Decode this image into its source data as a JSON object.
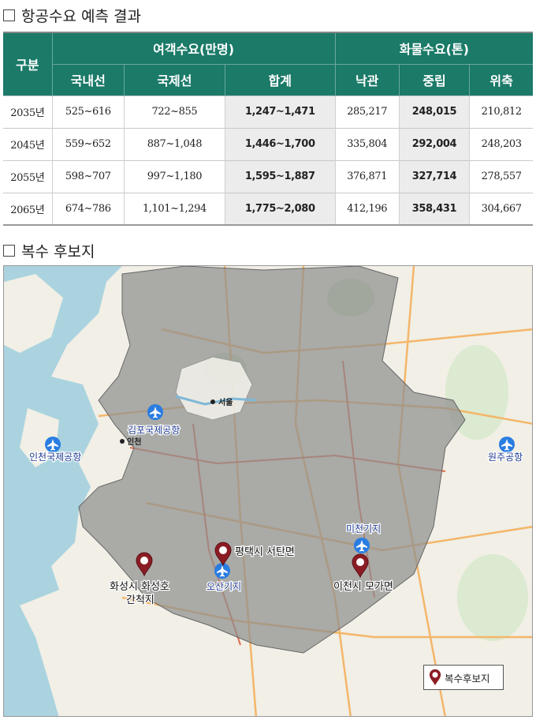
{
  "section1": {
    "title": "항공수요 예측 결과"
  },
  "table": {
    "corner": "구분",
    "group_passenger": "여객수요(만명)",
    "group_cargo": "화물수요(톤)",
    "sub": [
      "국내선",
      "국제선",
      "합계",
      "낙관",
      "중립",
      "위축"
    ],
    "rows": [
      [
        "2035년",
        "525~616",
        "722~855",
        "1,247~1,471",
        "285,217",
        "248,015",
        "210,812"
      ],
      [
        "2045년",
        "559~652",
        "887~1,048",
        "1,446~1,700",
        "335,804",
        "292,004",
        "248,203"
      ],
      [
        "2055년",
        "598~707",
        "997~1,180",
        "1,595~1,887",
        "376,871",
        "327,714",
        "278,557"
      ],
      [
        "2065년",
        "674~786",
        "1,101~1,294",
        "1,775~2,080",
        "412,196",
        "358,431",
        "304,667"
      ]
    ]
  },
  "section2": {
    "title": "복수 후보지"
  },
  "map": {
    "airports": [
      "김포국제공항",
      "인천국제공항",
      "원주공항",
      "오산기지",
      "미천기지"
    ],
    "candidates": [
      "평택시 서탄면",
      "화성시 화성호",
      "간척지",
      "이천시 모가면"
    ],
    "cities": [
      "서울",
      "인천"
    ],
    "legend": "복수후보지",
    "colors": {
      "region_fill": "#9a9a9a",
      "pin": "#8b1c24",
      "airport": "#2a7de1",
      "label": "#1f3a93"
    }
  }
}
